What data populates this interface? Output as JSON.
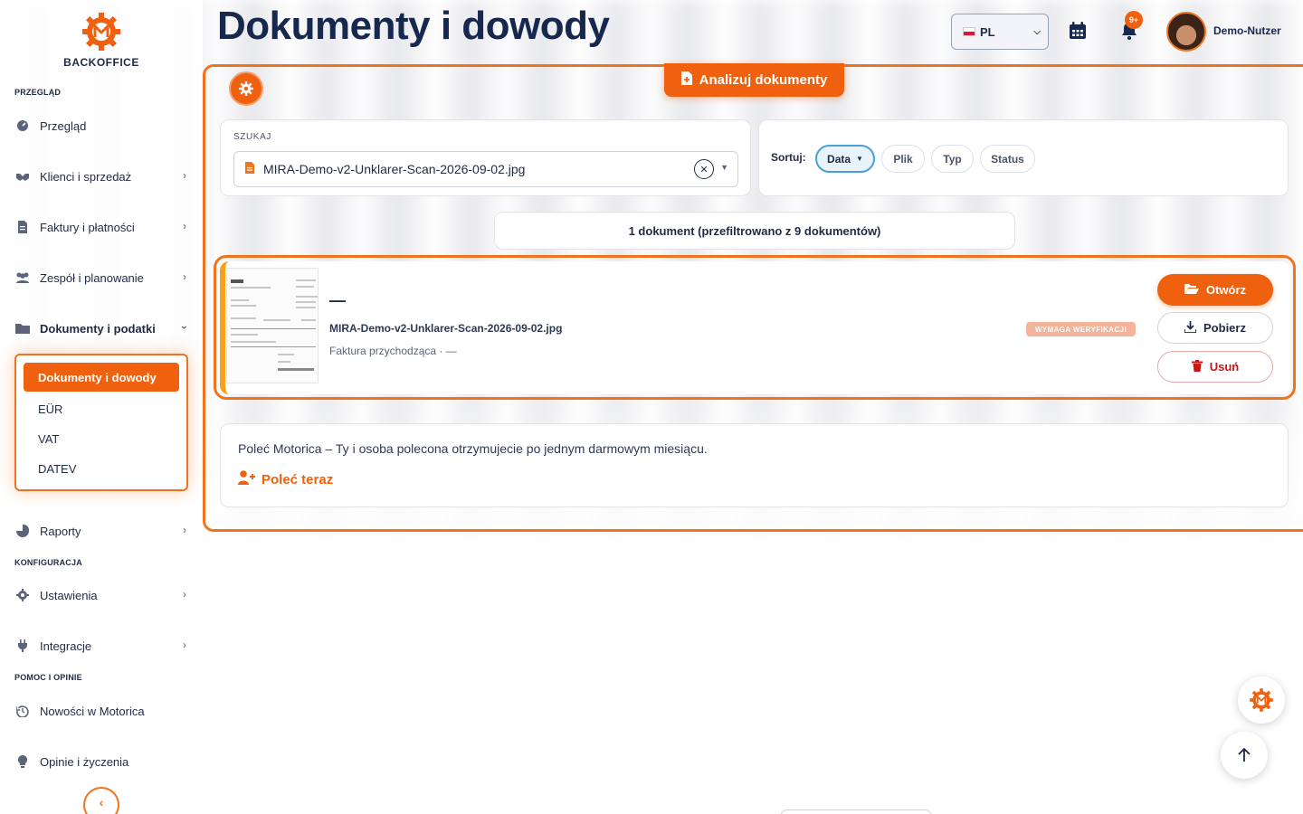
{
  "app": {
    "brand": "BACKOFFICE",
    "accent_color": "#f0610f",
    "page_title": "Dokumenty i dowody"
  },
  "sidebar": {
    "sections": {
      "overview": "PRZEGLĄD",
      "config": "KONFIGURACJA",
      "help": "POMOC I OPINIE"
    },
    "items": [
      {
        "label": "Przegląd",
        "icon": "dashboard-icon"
      },
      {
        "label": "Klienci i sprzedaż",
        "icon": "handshake-icon"
      },
      {
        "label": "Faktury i płatności",
        "icon": "invoice-icon"
      },
      {
        "label": "Zespół i planowanie",
        "icon": "team-icon"
      },
      {
        "label": "Dokumenty i podatki",
        "icon": "folder-icon"
      },
      {
        "label": "Raporty",
        "icon": "pie-chart-icon"
      },
      {
        "label": "Ustawienia",
        "icon": "gear-icon"
      },
      {
        "label": "Integracje",
        "icon": "plug-icon"
      },
      {
        "label": "Nowości w Motorica",
        "icon": "history-icon"
      },
      {
        "label": "Opinie i życzenia",
        "icon": "lightbulb-icon"
      }
    ],
    "submenu": {
      "active": "Dokumenty i dowody",
      "items": [
        "EÜR",
        "VAT",
        "DATEV"
      ]
    }
  },
  "header": {
    "language": "PL",
    "notification_count": "9+",
    "user_name": "Demo-Nutzer"
  },
  "main": {
    "analyze_button": "Analizuj dokumenty",
    "search": {
      "label": "SZUKAJ",
      "value": "MIRA-Demo-v2-Unklarer-Scan-2026-09-02.jpg"
    },
    "sort": {
      "label": "Sortuj:",
      "options": [
        "Data",
        "Plik",
        "Typ",
        "Status"
      ],
      "active": "Data"
    },
    "result_count": "1 dokument (przefiltrowano z 9 dokumentów)",
    "document": {
      "title": "—",
      "file_name": "MIRA-Demo-v2-Unklarer-Scan-2026-09-02.jpg",
      "meta": "Faktura przychodząca · —",
      "status": "WYMAGA WERYFIKACJI",
      "actions": {
        "open": "Otwórz",
        "download": "Pobierz",
        "delete": "Usuń"
      }
    },
    "referral": {
      "text": "Poleć Motorica – Ty i osoba polecona otrzymujecie po jednym darmowym miesiącu.",
      "link": "Poleć teraz"
    }
  }
}
